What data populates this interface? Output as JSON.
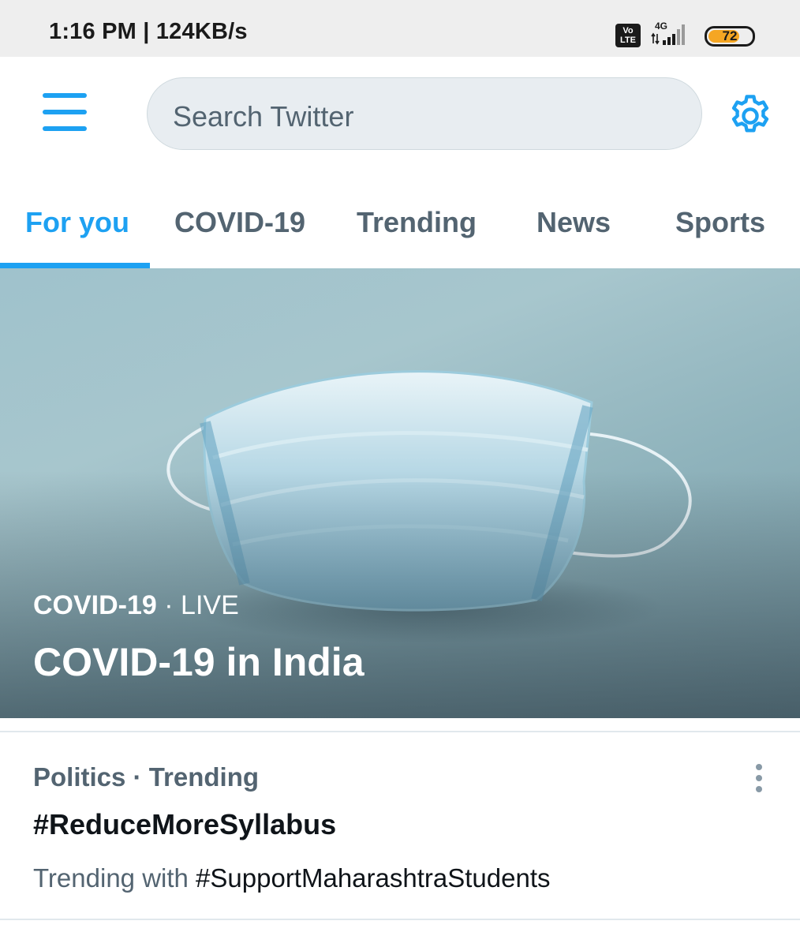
{
  "status_bar": {
    "time_speed": "1:16 PM | 124KB/s",
    "volte_label": "Vo LTE",
    "network": "4G",
    "battery": "72"
  },
  "search": {
    "placeholder": "Search Twitter"
  },
  "tabs": [
    {
      "label": "For you",
      "active": true
    },
    {
      "label": "COVID-19",
      "active": false
    },
    {
      "label": "Trending",
      "active": false
    },
    {
      "label": "News",
      "active": false
    },
    {
      "label": "Sports",
      "active": false
    }
  ],
  "hero": {
    "category": "COVID-19",
    "separator": " · ",
    "status": "LIVE",
    "title": "COVID-19 in India"
  },
  "trend": {
    "meta": "Politics · Trending",
    "title": "#ReduceMoreSyllabus",
    "with_prefix": "Trending with ",
    "with_tag": "#SupportMaharashtraStudents"
  },
  "colors": {
    "accent": "#1da1f2",
    "muted": "#536471",
    "battery": "#f5a623"
  },
  "icons": [
    "menu-icon",
    "gear-icon",
    "more-vertical-icon",
    "signal-icon",
    "battery-icon"
  ]
}
